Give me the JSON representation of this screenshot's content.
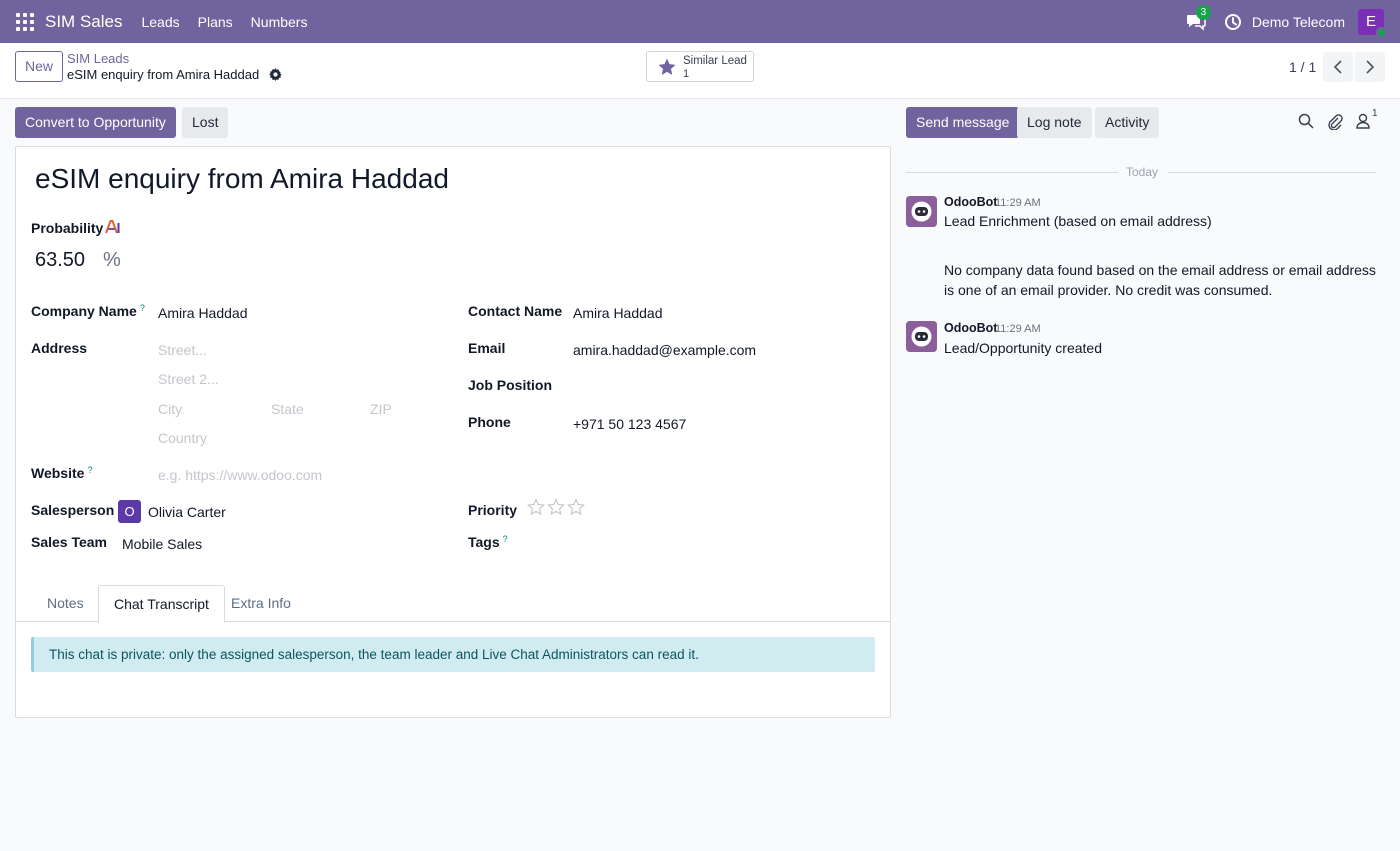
{
  "navbar": {
    "app_name": "SIM Sales",
    "menu": [
      "Leads",
      "Plans",
      "Numbers"
    ],
    "chat_badge": "3",
    "company": "Demo Telecom",
    "user_initial": "E"
  },
  "control": {
    "new_label": "New",
    "breadcrumb_parent": "SIM Leads",
    "breadcrumb_current": "eSIM enquiry from Amira Haddad",
    "similar_label": "Similar Lead",
    "similar_count": "1",
    "pager": "1 / 1"
  },
  "statusbar": {
    "convert_label": "Convert to Opportunity",
    "lost_label": "Lost"
  },
  "form": {
    "title": "eSIM enquiry from Amira Haddad",
    "probability_label": "Probability",
    "probability_value": "63.50",
    "probability_unit": "%",
    "company_name_label": "Company Name",
    "company_name_value": "Amira Haddad",
    "address_label": "Address",
    "street_placeholder": "Street...",
    "street2_placeholder": "Street 2...",
    "city_placeholder": "City",
    "state_placeholder": "State",
    "zip_placeholder": "ZIP",
    "country_placeholder": "Country",
    "website_label": "Website",
    "website_placeholder": "e.g. https://www.odoo.com",
    "salesperson_label": "Salesperson",
    "salesperson_initial": "O",
    "salesperson_value": "Olivia Carter",
    "sales_team_label": "Sales Team",
    "sales_team_value": "Mobile Sales",
    "contact_name_label": "Contact Name",
    "contact_name_value": "Amira Haddad",
    "email_label": "Email",
    "email_value": "amira.haddad@example.com",
    "job_position_label": "Job Position",
    "phone_label": "Phone",
    "phone_value": "+971 50 123 4567",
    "priority_label": "Priority",
    "priority_stars": 0,
    "priority_max": 3,
    "tags_label": "Tags",
    "help_mark": "?"
  },
  "tabs": {
    "items": [
      "Notes",
      "Chat Transcript",
      "Extra Info"
    ],
    "active": "Chat Transcript",
    "alert": "This chat is private: only the assigned salesperson, the team leader and Live Chat Administrators can read it."
  },
  "chatter": {
    "send_message_label": "Send message",
    "log_note_label": "Log note",
    "activity_label": "Activity",
    "followers_count": "1",
    "date_separator": "Today",
    "messages": [
      {
        "author": "OdooBot",
        "time": "11:29 AM",
        "body_line1": "Lead Enrichment (based on email address)",
        "body_line2": "No company data found based on the email address or email address is one of an email provider. No credit was consumed."
      },
      {
        "author": "OdooBot",
        "time": "11:29 AM",
        "body_line1": "Lead/Opportunity created"
      }
    ]
  },
  "colors": {
    "brand": "#71639e",
    "success": "#17a34a",
    "info_bg": "#d1ecf1"
  }
}
